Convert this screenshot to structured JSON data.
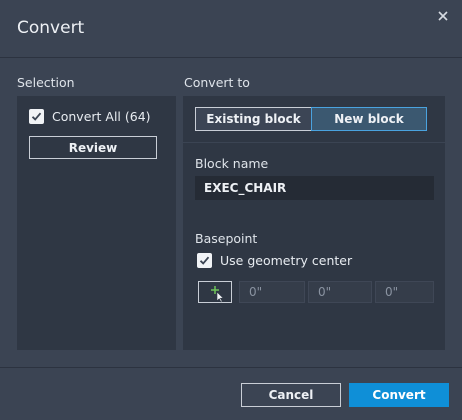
{
  "dialog": {
    "title": "Convert",
    "close_icon": "close-icon"
  },
  "selection": {
    "label": "Selection",
    "convert_all": {
      "label": "Convert All (64)",
      "checked": true
    },
    "review_label": "Review"
  },
  "convert_to": {
    "label": "Convert to",
    "options": [
      {
        "label": "Existing block",
        "selected": false
      },
      {
        "label": "New block",
        "selected": true
      }
    ],
    "block_name_label": "Block name",
    "block_name_value": "EXEC_CHAIR",
    "basepoint_label": "Basepoint",
    "use_geometry_center": {
      "label": "Use geometry center",
      "checked": true
    },
    "pick_point_icon": "pick-point-icon",
    "coords": {
      "x": "0\"",
      "y": "0\"",
      "z": "0\""
    }
  },
  "footer": {
    "cancel_label": "Cancel",
    "convert_label": "Convert"
  },
  "colors": {
    "background": "#3b4453",
    "panel": "#2f3744",
    "accent": "#0f8fd7",
    "selected_segment": "#3b5870"
  }
}
